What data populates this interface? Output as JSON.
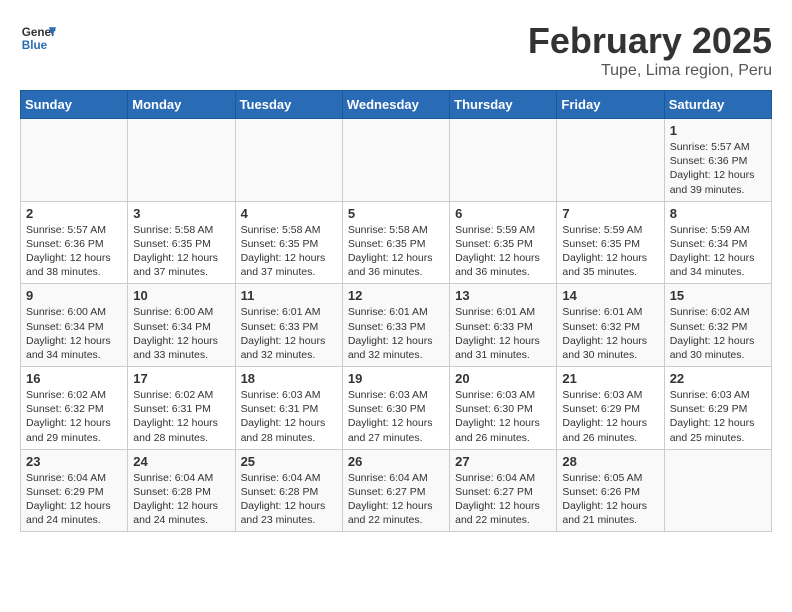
{
  "header": {
    "logo_general": "General",
    "logo_blue": "Blue",
    "title": "February 2025",
    "subtitle": "Tupe, Lima region, Peru"
  },
  "weekdays": [
    "Sunday",
    "Monday",
    "Tuesday",
    "Wednesday",
    "Thursday",
    "Friday",
    "Saturday"
  ],
  "weeks": [
    [
      {
        "day": "",
        "info": ""
      },
      {
        "day": "",
        "info": ""
      },
      {
        "day": "",
        "info": ""
      },
      {
        "day": "",
        "info": ""
      },
      {
        "day": "",
        "info": ""
      },
      {
        "day": "",
        "info": ""
      },
      {
        "day": "1",
        "info": "Sunrise: 5:57 AM\nSunset: 6:36 PM\nDaylight: 12 hours\nand 39 minutes."
      }
    ],
    [
      {
        "day": "2",
        "info": "Sunrise: 5:57 AM\nSunset: 6:36 PM\nDaylight: 12 hours\nand 38 minutes."
      },
      {
        "day": "3",
        "info": "Sunrise: 5:58 AM\nSunset: 6:35 PM\nDaylight: 12 hours\nand 37 minutes."
      },
      {
        "day": "4",
        "info": "Sunrise: 5:58 AM\nSunset: 6:35 PM\nDaylight: 12 hours\nand 37 minutes."
      },
      {
        "day": "5",
        "info": "Sunrise: 5:58 AM\nSunset: 6:35 PM\nDaylight: 12 hours\nand 36 minutes."
      },
      {
        "day": "6",
        "info": "Sunrise: 5:59 AM\nSunset: 6:35 PM\nDaylight: 12 hours\nand 36 minutes."
      },
      {
        "day": "7",
        "info": "Sunrise: 5:59 AM\nSunset: 6:35 PM\nDaylight: 12 hours\nand 35 minutes."
      },
      {
        "day": "8",
        "info": "Sunrise: 5:59 AM\nSunset: 6:34 PM\nDaylight: 12 hours\nand 34 minutes."
      }
    ],
    [
      {
        "day": "9",
        "info": "Sunrise: 6:00 AM\nSunset: 6:34 PM\nDaylight: 12 hours\nand 34 minutes."
      },
      {
        "day": "10",
        "info": "Sunrise: 6:00 AM\nSunset: 6:34 PM\nDaylight: 12 hours\nand 33 minutes."
      },
      {
        "day": "11",
        "info": "Sunrise: 6:01 AM\nSunset: 6:33 PM\nDaylight: 12 hours\nand 32 minutes."
      },
      {
        "day": "12",
        "info": "Sunrise: 6:01 AM\nSunset: 6:33 PM\nDaylight: 12 hours\nand 32 minutes."
      },
      {
        "day": "13",
        "info": "Sunrise: 6:01 AM\nSunset: 6:33 PM\nDaylight: 12 hours\nand 31 minutes."
      },
      {
        "day": "14",
        "info": "Sunrise: 6:01 AM\nSunset: 6:32 PM\nDaylight: 12 hours\nand 30 minutes."
      },
      {
        "day": "15",
        "info": "Sunrise: 6:02 AM\nSunset: 6:32 PM\nDaylight: 12 hours\nand 30 minutes."
      }
    ],
    [
      {
        "day": "16",
        "info": "Sunrise: 6:02 AM\nSunset: 6:32 PM\nDaylight: 12 hours\nand 29 minutes."
      },
      {
        "day": "17",
        "info": "Sunrise: 6:02 AM\nSunset: 6:31 PM\nDaylight: 12 hours\nand 28 minutes."
      },
      {
        "day": "18",
        "info": "Sunrise: 6:03 AM\nSunset: 6:31 PM\nDaylight: 12 hours\nand 28 minutes."
      },
      {
        "day": "19",
        "info": "Sunrise: 6:03 AM\nSunset: 6:30 PM\nDaylight: 12 hours\nand 27 minutes."
      },
      {
        "day": "20",
        "info": "Sunrise: 6:03 AM\nSunset: 6:30 PM\nDaylight: 12 hours\nand 26 minutes."
      },
      {
        "day": "21",
        "info": "Sunrise: 6:03 AM\nSunset: 6:29 PM\nDaylight: 12 hours\nand 26 minutes."
      },
      {
        "day": "22",
        "info": "Sunrise: 6:03 AM\nSunset: 6:29 PM\nDaylight: 12 hours\nand 25 minutes."
      }
    ],
    [
      {
        "day": "23",
        "info": "Sunrise: 6:04 AM\nSunset: 6:29 PM\nDaylight: 12 hours\nand 24 minutes."
      },
      {
        "day": "24",
        "info": "Sunrise: 6:04 AM\nSunset: 6:28 PM\nDaylight: 12 hours\nand 24 minutes."
      },
      {
        "day": "25",
        "info": "Sunrise: 6:04 AM\nSunset: 6:28 PM\nDaylight: 12 hours\nand 23 minutes."
      },
      {
        "day": "26",
        "info": "Sunrise: 6:04 AM\nSunset: 6:27 PM\nDaylight: 12 hours\nand 22 minutes."
      },
      {
        "day": "27",
        "info": "Sunrise: 6:04 AM\nSunset: 6:27 PM\nDaylight: 12 hours\nand 22 minutes."
      },
      {
        "day": "28",
        "info": "Sunrise: 6:05 AM\nSunset: 6:26 PM\nDaylight: 12 hours\nand 21 minutes."
      },
      {
        "day": "",
        "info": ""
      }
    ]
  ]
}
